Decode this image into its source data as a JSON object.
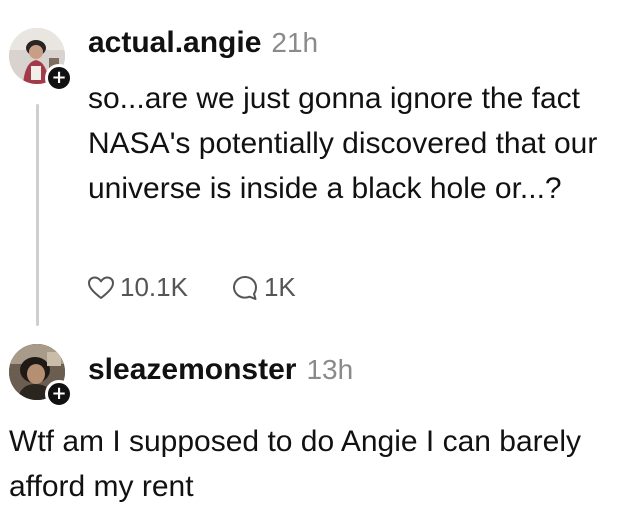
{
  "posts": [
    {
      "username": "actual.angie",
      "time": "21h",
      "text": "so...are we just gonna ignore the fact NASA's potentially discovered that our universe is inside a black hole or...?",
      "likes": "10.1K",
      "replies": "1K",
      "add_badge": "+"
    },
    {
      "username": "sleazemonster",
      "time": "13h",
      "text": "Wtf am I supposed to do Angie I can barely afford my rent",
      "add_badge": "+"
    }
  ]
}
